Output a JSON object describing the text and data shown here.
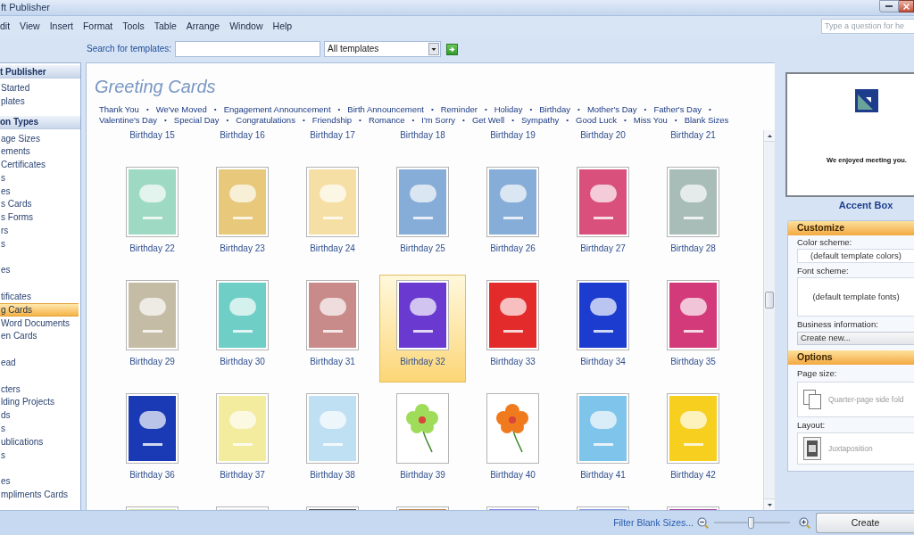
{
  "window": {
    "title": "ft Publisher"
  },
  "menu": [
    "dit",
    "View",
    "Insert",
    "Format",
    "Tools",
    "Table",
    "Arrange",
    "Window",
    "Help"
  ],
  "help_search": {
    "placeholder": "Type a question for he"
  },
  "template_search": {
    "label": "Search for templates:",
    "scope": "All templates"
  },
  "sidebar": {
    "sections": [
      {
        "header": "t Publisher",
        "groups": [
          [
            {
              "label": "Started",
              "selected": false
            },
            {
              "label": "plates",
              "selected": false
            }
          ]
        ]
      },
      {
        "header": "on Types",
        "groups": [
          [
            {
              "label": "age Sizes",
              "selected": false
            },
            {
              "label": "ements",
              "selected": false
            },
            {
              "label": "Certificates",
              "selected": false
            },
            {
              "label": "s",
              "selected": false
            },
            {
              "label": "es",
              "selected": false
            },
            {
              "label": "s Cards",
              "selected": false
            },
            {
              "label": "s Forms",
              "selected": false
            },
            {
              "label": "rs",
              "selected": false
            },
            {
              "label": "s",
              "selected": false
            }
          ],
          [
            {
              "label": "es",
              "selected": false
            }
          ],
          [
            {
              "label": "tificates",
              "selected": false
            },
            {
              "label": "g Cards",
              "selected": true
            },
            {
              "label": "Word Documents",
              "selected": false
            },
            {
              "label": "en Cards",
              "selected": false
            }
          ],
          [
            {
              "label": "ead",
              "selected": false
            }
          ],
          [
            {
              "label": "cters",
              "selected": false
            },
            {
              "label": "lding Projects",
              "selected": false
            },
            {
              "label": "ds",
              "selected": false
            },
            {
              "label": "s",
              "selected": false
            },
            {
              "label": "ublications",
              "selected": false
            },
            {
              "label": "s",
              "selected": false
            }
          ],
          [
            {
              "label": "es",
              "selected": false
            },
            {
              "label": "mpliments Cards",
              "selected": false
            }
          ]
        ]
      }
    ]
  },
  "content": {
    "title": "Greeting Cards",
    "separator": "•",
    "categories": [
      "Thank You",
      "We've Moved",
      "Engagement Announcement",
      "Birth Announcement",
      "Reminder",
      "Holiday",
      "Birthday",
      "Mother's Day",
      "Father's Day",
      "Valentine's Day",
      "Special Day",
      "Congratulations",
      "Friendship",
      "Romance",
      "I'm Sorry",
      "Get Well",
      "Sympathy",
      "Good Luck",
      "Miss You",
      "Blank Sizes"
    ],
    "top_row_labels": [
      "Birthday 15",
      "Birthday 16",
      "Birthday 17",
      "Birthday 18",
      "Birthday 19",
      "Birthday 20",
      "Birthday 21"
    ],
    "templates": [
      {
        "label": "Birthday 22",
        "selected": false,
        "kind": "solid",
        "color": "#9ed9c3"
      },
      {
        "label": "Birthday 23",
        "selected": false,
        "kind": "solid",
        "color": "#e8c87a"
      },
      {
        "label": "Birthday 24",
        "selected": false,
        "kind": "solid",
        "color": "#f6dfa4"
      },
      {
        "label": "Birthday 25",
        "selected": false,
        "kind": "solid",
        "color": "#86acd8"
      },
      {
        "label": "Birthday 26",
        "selected": false,
        "kind": "solid",
        "color": "#86acd8"
      },
      {
        "label": "Birthday 27",
        "selected": false,
        "kind": "solid",
        "color": "#d9507c"
      },
      {
        "label": "Birthday 28",
        "selected": false,
        "kind": "solid",
        "color": "#a9bdb8"
      },
      {
        "label": "Birthday 29",
        "selected": false,
        "kind": "solid",
        "color": "#c4bca4"
      },
      {
        "label": "Birthday 30",
        "selected": false,
        "kind": "solid",
        "color": "#6fcfc6"
      },
      {
        "label": "Birthday 31",
        "selected": false,
        "kind": "solid",
        "color": "#c98a8a"
      },
      {
        "label": "Birthday 32",
        "selected": true,
        "kind": "solid",
        "color": "#6a3ad0"
      },
      {
        "label": "Birthday 33",
        "selected": false,
        "kind": "solid",
        "color": "#e32b2b"
      },
      {
        "label": "Birthday 34",
        "selected": false,
        "kind": "solid",
        "color": "#1b3ccf"
      },
      {
        "label": "Birthday 35",
        "selected": false,
        "kind": "solid",
        "color": "#d33a7a"
      },
      {
        "label": "Birthday 36",
        "selected": false,
        "kind": "solid",
        "color": "#1a3ab5"
      },
      {
        "label": "Birthday 37",
        "selected": false,
        "kind": "solid",
        "color": "#f3eb9e"
      },
      {
        "label": "Birthday 38",
        "selected": false,
        "kind": "solid",
        "color": "#bfe0f2"
      },
      {
        "label": "Birthday 39",
        "selected": false,
        "kind": "flower",
        "color": "#9fdc5a"
      },
      {
        "label": "Birthday 40",
        "selected": false,
        "kind": "flower",
        "color": "#f07a1e"
      },
      {
        "label": "Birthday 41",
        "selected": false,
        "kind": "solid",
        "color": "#7fc4ea"
      },
      {
        "label": "Birthday 42",
        "selected": false,
        "kind": "solid",
        "color": "#f7cf1f"
      }
    ],
    "cut_off_row": [
      {
        "color": "#d6e4a8"
      },
      {
        "color": "#e6e6e6"
      },
      {
        "color": "#505050"
      },
      {
        "color": "#c08048"
      },
      {
        "color": "#8282e0"
      },
      {
        "color": "#8294e0"
      },
      {
        "color": "#a040a0"
      }
    ]
  },
  "preview": {
    "message": "We enjoyed meeting you.",
    "name": "Accent Box"
  },
  "customize": {
    "title": "Customize",
    "fields": [
      {
        "kind": "text_field",
        "label": "Color scheme:",
        "value": "(default template colors)"
      },
      {
        "kind": "preview_box",
        "label": "Font scheme:",
        "value": "(default template fonts)"
      },
      {
        "kind": "dropdown",
        "label": "Business information:",
        "value": "Create new..."
      }
    ]
  },
  "options": {
    "title": "Options",
    "fields": [
      {
        "kind": "page_size",
        "label": "Page size:",
        "value": "Quarter-page side fold",
        "disabled": true
      },
      {
        "kind": "layout",
        "label": "Layout:",
        "value": "Juxtaposition",
        "disabled": true
      }
    ]
  },
  "status_bar": {
    "filter_link": "Filter Blank Sizes...",
    "zoom": {
      "level": 0.48
    },
    "create_button": "Create"
  }
}
